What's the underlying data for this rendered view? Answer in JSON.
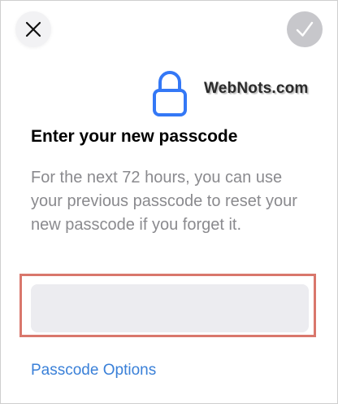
{
  "header": {
    "close_icon": "close-icon",
    "confirm_icon": "checkmark-icon",
    "confirm_enabled": false
  },
  "lock": {
    "icon": "lock-icon",
    "color": "#3478f6"
  },
  "watermark": {
    "text": "WebNots.com"
  },
  "content": {
    "title": "Enter your new passcode",
    "description": "For the next 72 hours, you can use your previous passcode to reset your new passcode if you forget it."
  },
  "passcode": {
    "value": "",
    "placeholder": ""
  },
  "options": {
    "label": "Passcode Options"
  },
  "colors": {
    "accent": "#3a80d8",
    "highlight": "#d9776c",
    "disabled_button": "#c7c7cb",
    "secondary_text": "#8a8a8e"
  }
}
